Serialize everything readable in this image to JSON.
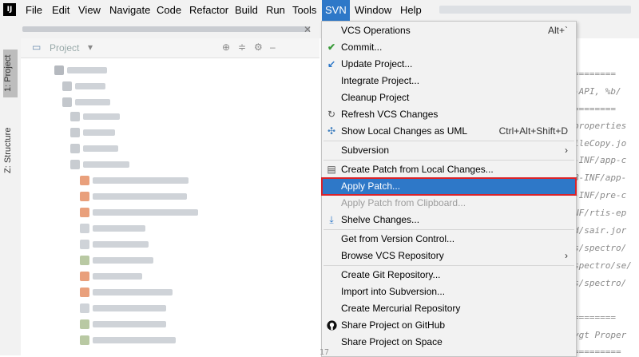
{
  "app": {
    "logo_text": "IJ"
  },
  "menubar": {
    "items": [
      "File",
      "Edit",
      "View",
      "Navigate",
      "Code",
      "Refactor",
      "Build",
      "Run",
      "Tools",
      "SVN",
      "Window",
      "Help"
    ],
    "active": "SVN"
  },
  "left_strip": {
    "tabs": [
      "1: Project",
      "Z: Structure"
    ]
  },
  "project_panel": {
    "title": "Project"
  },
  "svn_menu": {
    "items": [
      {
        "label": "VCS Operations",
        "shortcut": "Alt+`",
        "icon": ""
      },
      {
        "label": "Commit...",
        "shortcut": "",
        "icon": "check-icon"
      },
      {
        "label": "Update Project...",
        "shortcut": "",
        "icon": "update-arrow-icon"
      },
      {
        "label": "Integrate Project...",
        "shortcut": "",
        "icon": ""
      },
      {
        "label": "Cleanup Project",
        "shortcut": "",
        "icon": ""
      },
      {
        "label": "Refresh VCS Changes",
        "shortcut": "",
        "icon": "refresh-icon"
      },
      {
        "label": "Show Local Changes as UML",
        "shortcut": "Ctrl+Alt+Shift+D",
        "icon": "uml-icon"
      },
      {
        "label": "Subversion",
        "shortcut": "",
        "icon": "",
        "submenu": true
      },
      {
        "label": "Create Patch from Local Changes...",
        "shortcut": "",
        "icon": "patch-icon"
      },
      {
        "label": "Apply Patch...",
        "shortcut": "",
        "icon": ""
      },
      {
        "label": "Apply Patch from Clipboard...",
        "shortcut": "",
        "icon": ""
      },
      {
        "label": "Shelve Changes...",
        "shortcut": "",
        "icon": "shelve-icon"
      },
      {
        "label": "Get from Version Control...",
        "shortcut": "",
        "icon": ""
      },
      {
        "label": "Browse VCS Repository",
        "shortcut": "",
        "icon": "",
        "submenu": true
      },
      {
        "label": "Create Git Repository...",
        "shortcut": "",
        "icon": ""
      },
      {
        "label": "Import into Subversion...",
        "shortcut": "",
        "icon": ""
      },
      {
        "label": "Create Mercurial Repository",
        "shortcut": "",
        "icon": ""
      },
      {
        "label": "Share Project on GitHub",
        "shortcut": "",
        "icon": "github-icon"
      },
      {
        "label": "Share Project on Space",
        "shortcut": "",
        "icon": ""
      }
    ],
    "highlighted": "Apply Patch...",
    "disabled": "Apply Patch from Clipboard..."
  },
  "editor": {
    "code_lines": [
      "========",
      "-API, %b/",
      "========",
      "properties",
      "ileCopy.jo",
      "-INF/app-c",
      "B-INF/app-",
      "-INF/pre-c",
      "NF/rtis-ep",
      "d/sair.jor",
      "s/spectro/",
      "spectro/se/",
      "s/spectro/",
      "",
      "========",
      "ygt Proper",
      "========="
    ],
    "gutter_number": "17"
  },
  "colors": {
    "accent": "#2e78c8",
    "highlight_border": "#d9232a",
    "check": "#3a9b3a"
  }
}
